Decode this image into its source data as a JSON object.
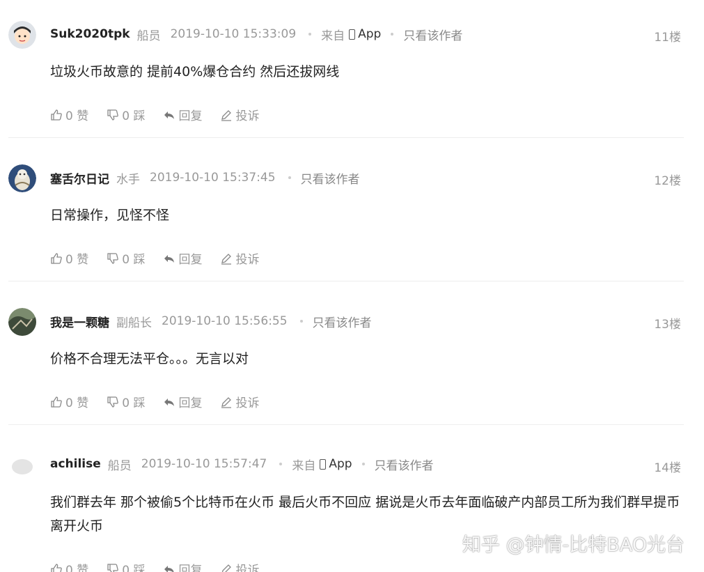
{
  "actions_labels": {
    "like": "0 赞",
    "dislike": "0 踩",
    "reply": "回复",
    "report": "投诉"
  },
  "posts": [
    {
      "author": "Suk2020tpk",
      "role": "船员",
      "time": "2019-10-10 15:33:09",
      "source_prefix": "来自",
      "source_app": "App",
      "only_author": "只看该作者",
      "floor": "11楼",
      "content": "垃圾火币故意的 提前40%爆仓合约 然后还拔网线"
    },
    {
      "author": "塞舌尔日记",
      "role": "水手",
      "time": "2019-10-10 15:37:45",
      "only_author": "只看该作者",
      "floor": "12楼",
      "content": "日常操作，见怪不怪"
    },
    {
      "author": "我是一颗糖",
      "role": "副船长",
      "time": "2019-10-10 15:56:55",
      "only_author": "只看该作者",
      "floor": "13楼",
      "content": "价格不合理无法平仓。。。无言以对"
    },
    {
      "author": "achilise",
      "role": "船员",
      "time": "2019-10-10 15:57:47",
      "source_prefix": "来自",
      "source_app": "App",
      "only_author": "只看该作者",
      "floor": "14楼",
      "content": "我们群去年 那个被偷5个比特币在火币 最后火币不回应 据说是火币去年面临破产内部员工所为我们群早提币离开火币"
    }
  ],
  "watermark": "知乎 @钟情-比特BAO光台"
}
